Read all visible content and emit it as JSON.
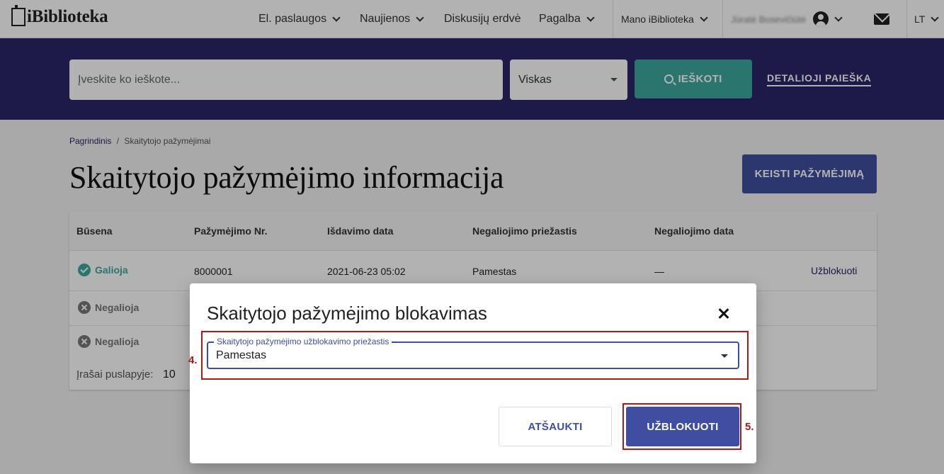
{
  "header": {
    "logo_text": "iBiblioteka",
    "nav": [
      {
        "label": "El. paslaugos"
      },
      {
        "label": "Naujienos"
      },
      {
        "label": "Diskusijų erdvė"
      },
      {
        "label": "Pagalba"
      }
    ],
    "my_library": "Mano iBiblioteka",
    "user_name": "Jūratė Bosevičiūtė",
    "language": "LT"
  },
  "search": {
    "placeholder": "Įveskite ko ieškote...",
    "scope": "Viskas",
    "button_label": "IEŠKOTI",
    "advanced_link": "DETALIOJI PAIEŠKA"
  },
  "breadcrumb": {
    "home": "Pagrindinis",
    "separator": "/",
    "current": "Skaitytojo pažymėjimai"
  },
  "page": {
    "title": "Skaitytojo pažymėjimo informacija",
    "change_button": "KEISTI PAŽYMĖJIMĄ"
  },
  "table": {
    "headers": [
      "Būsena",
      "Pažymėjimo Nr.",
      "Išdavimo data",
      "Negaliojimo priežastis",
      "Negaliojimo data"
    ],
    "rows": [
      {
        "status": "Galioja",
        "number": "8000001",
        "issued": "2021-06-23 05:02",
        "reason": "Pamestas",
        "invalid_date": "—",
        "action": "Užblokuoti"
      },
      {
        "status": "Negalioja"
      },
      {
        "status": "Negalioja"
      }
    ],
    "per_page_label": "Įrašai puslapyje:",
    "per_page_value": "10"
  },
  "dialog": {
    "title": "Skaitytojo pažymėjimo blokavimas",
    "field_label": "Skaitytojo pažymėjimo užblokavimo priežastis",
    "field_value": "Pamestas",
    "cancel_label": "ATŠAUKTI",
    "confirm_label": "UŽBLOKUOTI",
    "step_markers": [
      "4.",
      "5."
    ]
  },
  "colors": {
    "brand_navy": "#2a2468",
    "primary_button": "#3f4ea0",
    "search_teal": "#3ea8a0",
    "annotation_red": "#b01818"
  }
}
